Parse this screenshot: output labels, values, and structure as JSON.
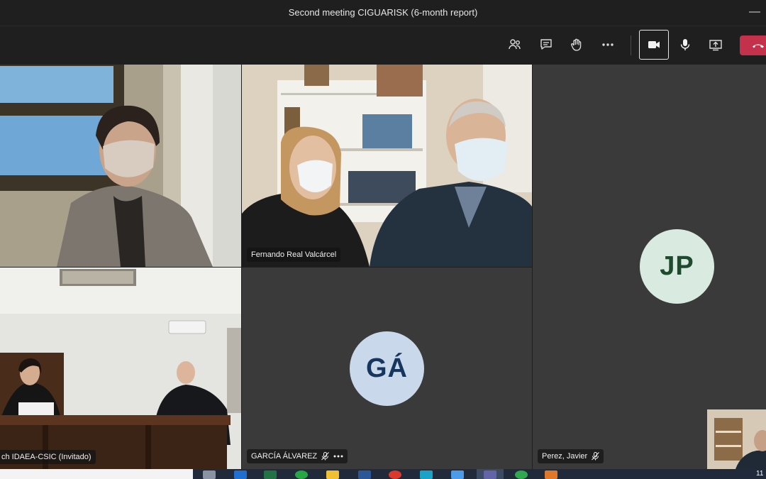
{
  "window": {
    "title": "Second meeting CIGUARISK (6-month report)",
    "minimize_glyph": "—"
  },
  "toolbar": {
    "icons": [
      "people-icon",
      "chat-icon",
      "raise-hand-icon",
      "more-options-icon",
      "camera-icon",
      "microphone-icon",
      "share-screen-icon",
      "hang-up-icon"
    ],
    "accent_color": "#c4314b"
  },
  "participants": {
    "fernando": {
      "name": "Fernando Real Valcárcel"
    },
    "idaea": {
      "name": "ch IDAEA-CSIC (Invitado)"
    },
    "garcia": {
      "name": "GARCÍA ÁLVAREZ",
      "initials": "GÁ",
      "avatar_bg": "#c9d8ea",
      "avatar_fg": "#17365d",
      "muted": true
    },
    "perez": {
      "name": "Perez, Javier",
      "initials": "JP",
      "avatar_bg": "#d9ebe0",
      "avatar_fg": "#1e4a2d",
      "muted": true
    }
  },
  "taskbar": {
    "clock_partial": "11"
  }
}
